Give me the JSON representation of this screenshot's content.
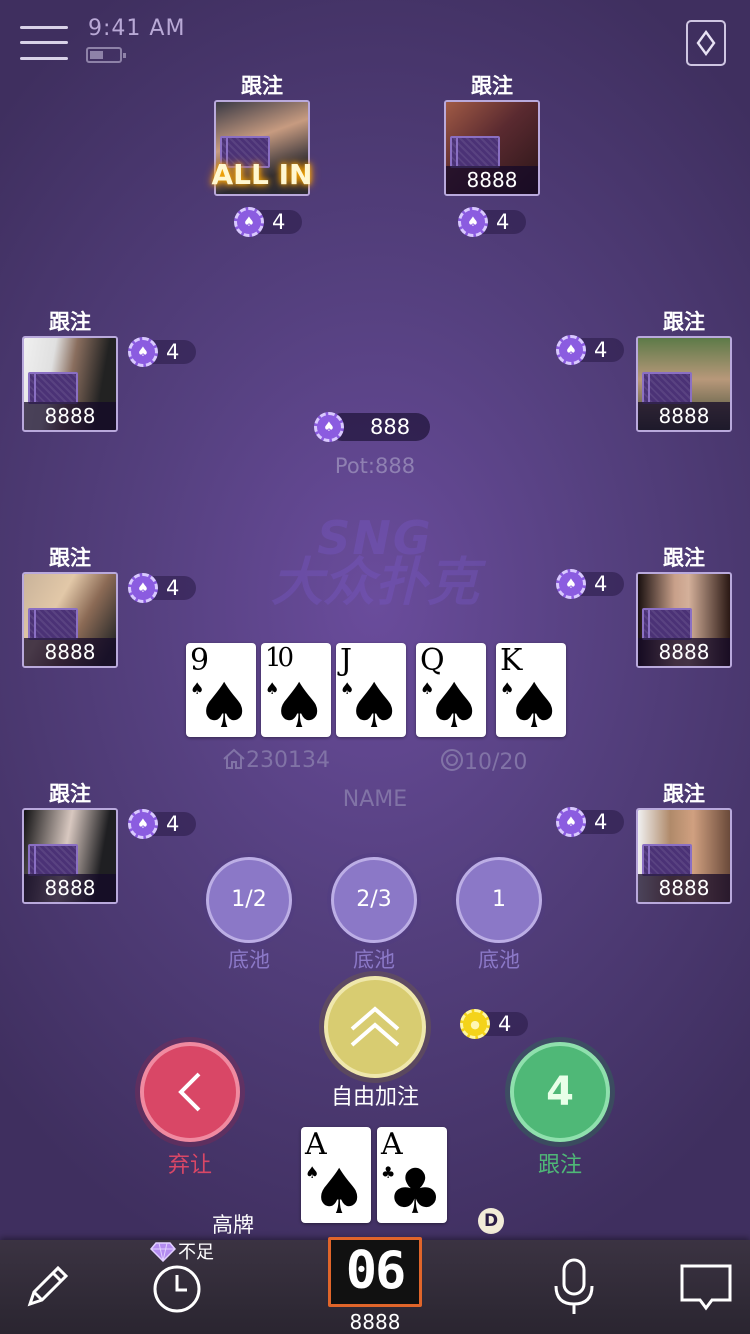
{
  "status": {
    "time": "9:41 AM"
  },
  "players": [
    {
      "id": "top-left",
      "action": "跟注",
      "chips": "",
      "all_in": "ALL IN",
      "bet": "4",
      "photo": "#2a2a33"
    },
    {
      "id": "top-right",
      "action": "跟注",
      "chips": "8888",
      "all_in": "",
      "bet": "4",
      "photo": "#5a2a30"
    },
    {
      "id": "upper-left",
      "action": "跟注",
      "chips": "8888",
      "all_in": "",
      "bet": "4",
      "photo": "#d9d9d9"
    },
    {
      "id": "upper-right",
      "action": "跟注",
      "chips": "8888",
      "all_in": "",
      "bet": "4",
      "photo": "#3b4a33"
    },
    {
      "id": "middle-left",
      "action": "跟注",
      "chips": "8888",
      "all_in": "",
      "bet": "4",
      "photo": "#8b6a55"
    },
    {
      "id": "middle-right",
      "action": "跟注",
      "chips": "8888",
      "all_in": "",
      "bet": "4",
      "photo": "#3a2420"
    },
    {
      "id": "lower-left",
      "action": "跟注",
      "chips": "8888",
      "all_in": "",
      "bet": "4",
      "photo": "#1f1f22"
    },
    {
      "id": "lower-right",
      "action": "跟注",
      "chips": "8888",
      "all_in": "",
      "bet": "4",
      "photo": "#b08a6a"
    }
  ],
  "pot": {
    "amount": "888",
    "label": "Pot:888"
  },
  "watermark": {
    "line1": "SNG",
    "line2": "大众扑克"
  },
  "board": [
    {
      "rank": "9",
      "suit": "♠"
    },
    {
      "rank": "10",
      "suit": "♠"
    },
    {
      "rank": "J",
      "suit": "♠"
    },
    {
      "rank": "Q",
      "suit": "♠"
    },
    {
      "rank": "K",
      "suit": "♠"
    }
  ],
  "room": {
    "id": "230134",
    "blinds": "10/20",
    "name": "NAME"
  },
  "pot_sizes": [
    {
      "value": "1/2",
      "label": "底池"
    },
    {
      "value": "2/3",
      "label": "底池"
    },
    {
      "value": "1",
      "label": "底池"
    }
  ],
  "actions": {
    "raise_label": "自由加注",
    "fold_label": "弃让",
    "call_amount": "4",
    "call_label": "跟注",
    "my_bet": "4"
  },
  "hand": {
    "cards": [
      {
        "rank": "A",
        "suit": "♠"
      },
      {
        "rank": "A",
        "suit": "♣"
      }
    ],
    "rank_name": "高牌",
    "dealer": "D"
  },
  "me": {
    "gem_text": "不足",
    "timer": "06",
    "chips": "8888"
  },
  "colors": {
    "fold": "#d94766",
    "call": "#4fb877",
    "raise": "#d8cc71",
    "timer_border": "#e0652a"
  },
  "toolbar": {
    "icons": [
      "pencil-icon",
      "clock-icon",
      "microphone-icon",
      "chat-icon"
    ]
  }
}
